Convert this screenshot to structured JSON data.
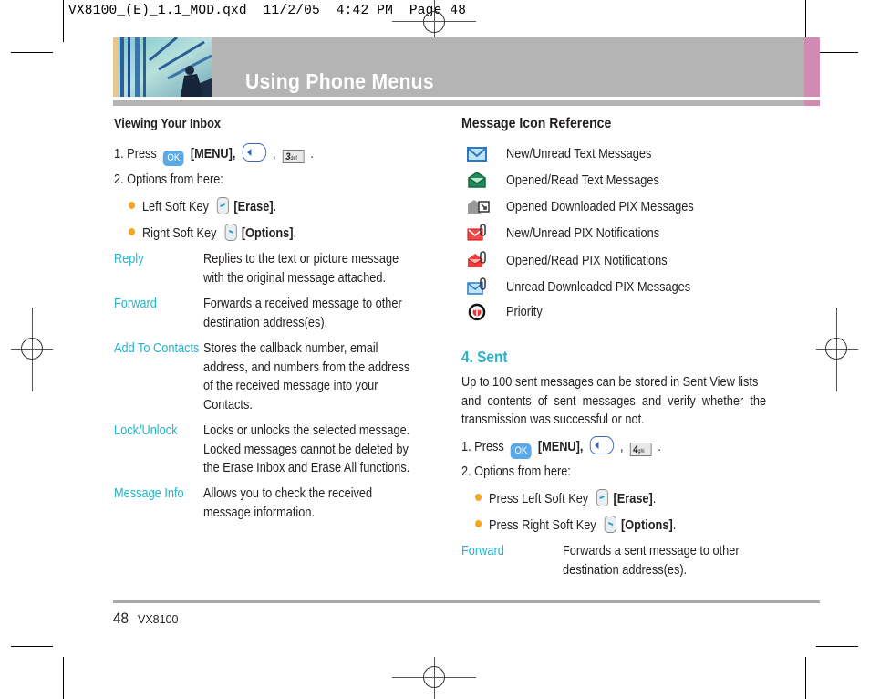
{
  "slug": "VX8100_(E)_1.1_MOD.qxd  11/2/05  4:42 PM  Page 48",
  "header": {
    "title": "Using Phone Menus"
  },
  "colors": {
    "banner_gray": "#b5b4b4",
    "accent_pink": "#d18bb3",
    "term_cyan": "#26b3c9",
    "bullet_orange": "#f5a623"
  },
  "left": {
    "heading": "Viewing Your Inbox",
    "step1": {
      "prefix": "1.  Press",
      "ok_key": "OK",
      "menu_label": "[MENU],",
      "sep": ",",
      "num_key": "3",
      "num_key_sub": "def",
      "end": "."
    },
    "step2": "2.  Options from here:",
    "bullets": [
      {
        "text": "Left Soft Key",
        "action": "[Erase]",
        "end": "."
      },
      {
        "text": "Right Soft Key",
        "action": "[Options]",
        "end": "."
      }
    ],
    "terms": [
      {
        "term": "Reply",
        "lines": [
          "Replies to the text or picture message",
          "with the original message attached."
        ]
      },
      {
        "term": "Forward",
        "lines": [
          "Forwards a received message to other",
          "destination address(es)."
        ]
      },
      {
        "term": "Add To Contacts",
        "lines": [
          "Stores the callback number, email",
          "address, and numbers from the address",
          "of the received message into your",
          "Contacts."
        ]
      },
      {
        "term": "Lock/Unlock",
        "lines": [
          "Locks or unlocks the selected message.",
          "Locked messages cannot be deleted by",
          "the Erase Inbox and Erase All functions."
        ]
      },
      {
        "term": "Message Info",
        "lines": [
          "Allows you to check the received",
          "message information."
        ]
      }
    ]
  },
  "right": {
    "icon_ref_heading": "Message Icon Reference",
    "icons": [
      {
        "icon": "envelope-new-icon",
        "label": "New/Unread Text Messages"
      },
      {
        "icon": "envelope-opened-icon",
        "label": "Opened/Read Text Messages"
      },
      {
        "icon": "pix-downloaded-opened-icon",
        "label": "Opened Downloaded PIX Messages"
      },
      {
        "icon": "pix-notification-new-icon",
        "label": "New/Unread PIX Notifications"
      },
      {
        "icon": "pix-notification-opened-icon",
        "label": "Opened/Read PIX Notifications"
      },
      {
        "icon": "pix-downloaded-unread-icon",
        "label": "Unread Downloaded PIX Messages"
      },
      {
        "icon": "priority-icon",
        "label": "Priority"
      }
    ],
    "sent_heading": "4. Sent",
    "sent_para": [
      "Up to 100 sent messages can be stored in Sent View lists",
      "and  contents  of  sent  messages  and  verify  whether  the",
      "transmission was successful or not."
    ],
    "step1": {
      "prefix": "1.  Press",
      "ok_key": "OK",
      "menu_label": "[MENU],",
      "sep": ",",
      "num_key": "4",
      "num_key_sub": "ghi",
      "end": "."
    },
    "step2": "2.  Options from here:",
    "bullets": [
      {
        "text": "Press Left Soft Key",
        "action": "[Erase]",
        "end": "."
      },
      {
        "text": "Press Right Soft Key",
        "action": "[Options]",
        "end": "."
      }
    ],
    "terms": [
      {
        "term": "Forward",
        "lines": [
          "Forwards a sent message to other",
          "destination address(es)."
        ]
      }
    ]
  },
  "footer": {
    "page_number": "48",
    "model": "VX8100"
  }
}
